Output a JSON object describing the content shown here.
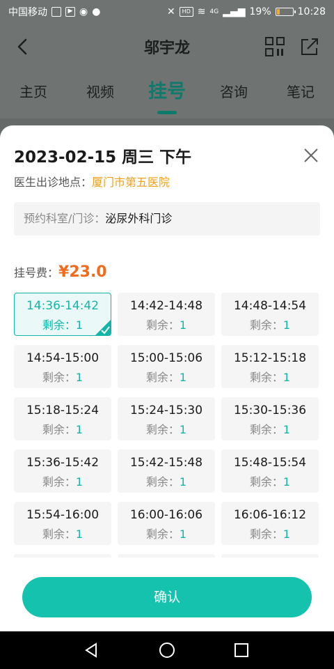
{
  "status_bar": {
    "carrier": "中国移动",
    "battery": "19%",
    "battery_level": 0.19,
    "time": "10:28",
    "hd_badge": "HD",
    "net_badge": "4G"
  },
  "header": {
    "title": "邬宇龙"
  },
  "tabs": [
    {
      "label": "主页"
    },
    {
      "label": "视频"
    },
    {
      "label": "挂号",
      "active": true
    },
    {
      "label": "咨询"
    },
    {
      "label": "笔记"
    }
  ],
  "sheet": {
    "session_title": "2023-02-15 周三 下午",
    "location_label": "医生出诊地点：",
    "location_value": "厦门市第五医院",
    "dept_label": "预约科室/门诊：",
    "dept_value": "泌尿外科门诊",
    "fee_label": "挂号费：",
    "fee_value": "¥23.0",
    "remain_label": "剩余：",
    "slots": [
      {
        "time": "14:36-14:42",
        "remain": "1",
        "selected": true
      },
      {
        "time": "14:42-14:48",
        "remain": "1"
      },
      {
        "time": "14:48-14:54",
        "remain": "1"
      },
      {
        "time": "14:54-15:00",
        "remain": "1"
      },
      {
        "time": "15:00-15:06",
        "remain": "1"
      },
      {
        "time": "15:12-15:18",
        "remain": "1"
      },
      {
        "time": "15:18-15:24",
        "remain": "1"
      },
      {
        "time": "15:24-15:30",
        "remain": "1"
      },
      {
        "time": "15:30-15:36",
        "remain": "1"
      },
      {
        "time": "15:36-15:42",
        "remain": "1"
      },
      {
        "time": "15:42-15:48",
        "remain": "1"
      },
      {
        "time": "15:48-15:54",
        "remain": "1"
      },
      {
        "time": "15:54-16:00",
        "remain": "1"
      },
      {
        "time": "16:00-16:06",
        "remain": "1"
      },
      {
        "time": "16:06-16:12",
        "remain": "1"
      }
    ],
    "confirm_label": "确认"
  },
  "colors": {
    "accent": "#14c2ae",
    "fee": "#f26a1b",
    "location": "#f0a01a"
  }
}
